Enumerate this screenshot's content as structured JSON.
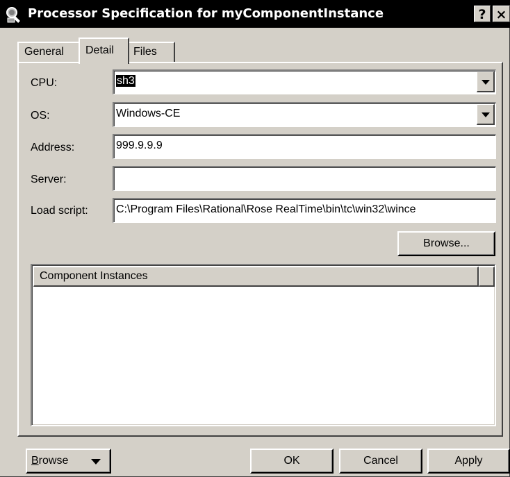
{
  "window": {
    "title": "Processor Specification for myComponentInstance",
    "help_label": "?",
    "close_label": "×"
  },
  "tabs": [
    {
      "label": "General",
      "selected": false
    },
    {
      "label": "Detail",
      "selected": true
    },
    {
      "label": "Files",
      "selected": false
    }
  ],
  "form": {
    "cpu": {
      "label": "CPU:",
      "value": "sh3",
      "text_selected": true
    },
    "os": {
      "label": "OS:",
      "value": "Windows-CE"
    },
    "address": {
      "label": "Address:",
      "value": "999.9.9.9"
    },
    "server": {
      "label": "Server:",
      "value": ""
    },
    "load_script": {
      "label": "Load script:",
      "value": "C:\\Program Files\\Rational\\Rose RealTime\\bin\\tc\\win32\\wince"
    },
    "browse_label": "Browse..."
  },
  "list": {
    "columns": [
      "Component Instances",
      ""
    ],
    "rows": []
  },
  "footer": {
    "browse_first": "B",
    "browse_rest": "rowse",
    "ok_label": "OK",
    "cancel_label": "Cancel",
    "apply_label": "Apply"
  },
  "icons": {
    "title_icon": "magnifier-processor-icon",
    "dropdown": "chevron-down-icon"
  },
  "colors": {
    "titlebar_bg": "#000000",
    "dialog_bg": "#d4d0c8",
    "selection_bg": "#000000"
  }
}
